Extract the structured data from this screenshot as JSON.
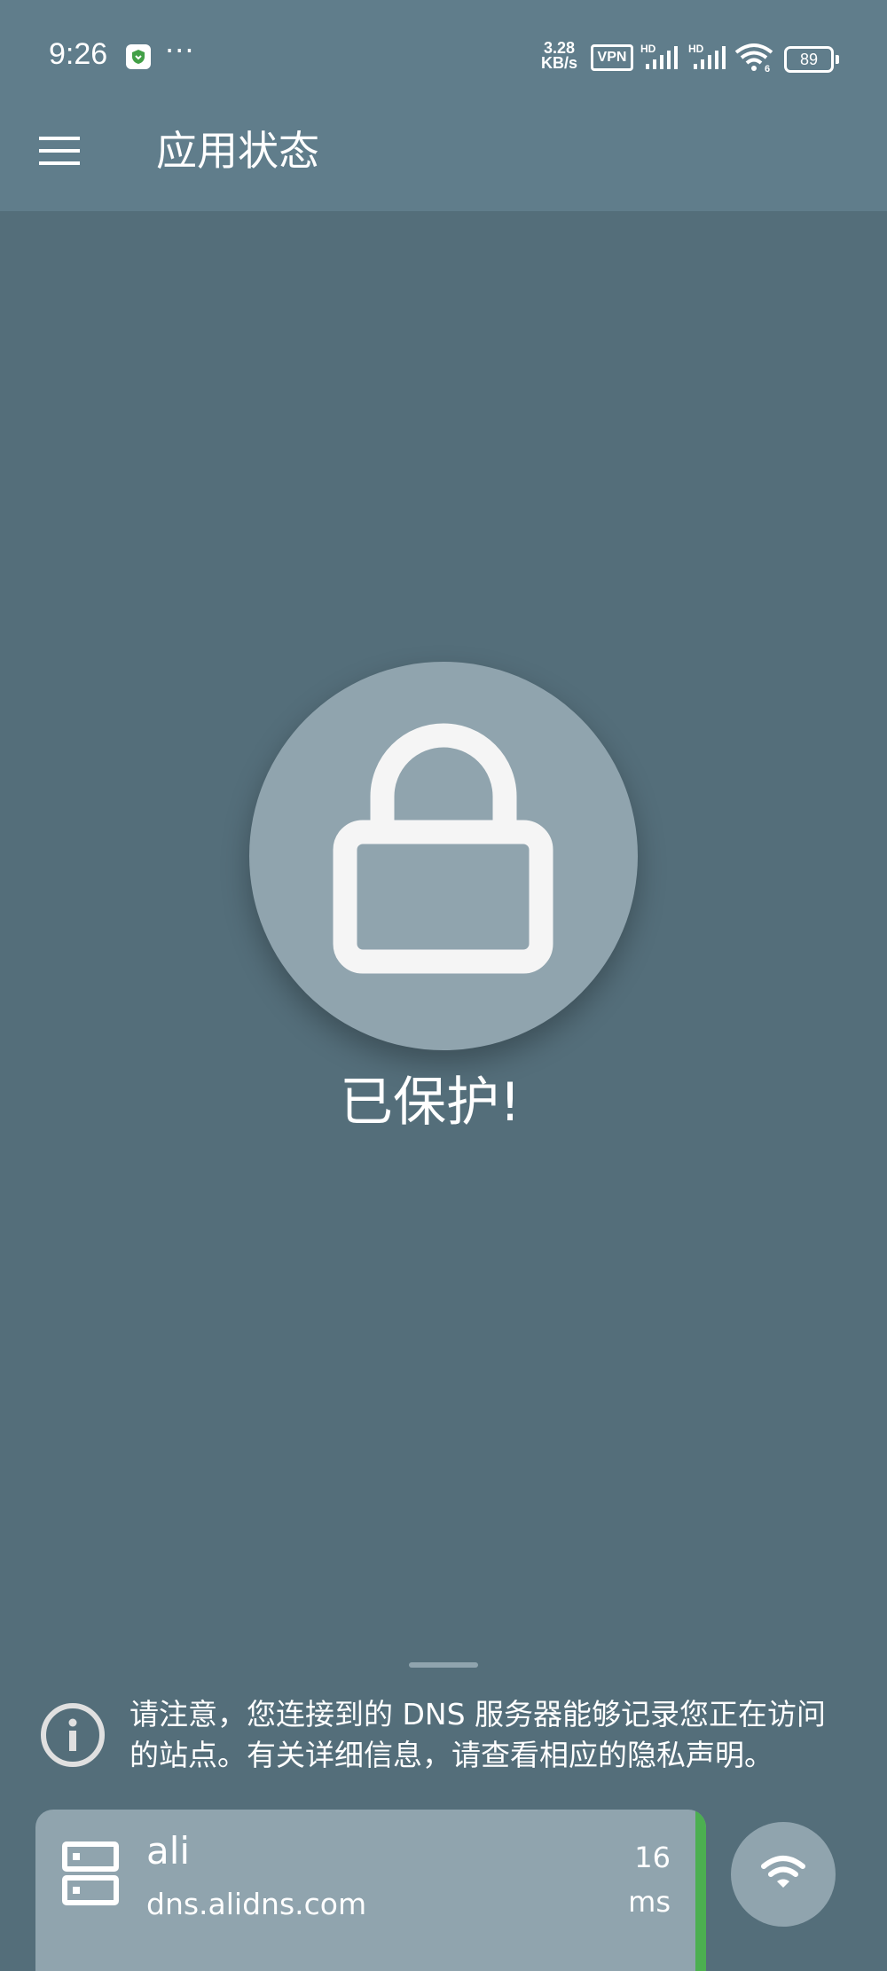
{
  "status_bar": {
    "time": "9:26",
    "net_speed_value": "3.28",
    "net_speed_unit": "KB/s",
    "vpn_label": "VPN",
    "signal_label": "HD",
    "wifi_label": "6",
    "battery_level": "89"
  },
  "header": {
    "title": "应用状态"
  },
  "main": {
    "status_text": "已保护!"
  },
  "notice": {
    "text": "请注意，您连接到的 DNS 服务器能够记录您正在访问的站点。有关详细信息，请查看相应的隐私声明。"
  },
  "server": {
    "name": "ali",
    "host": "dns.alidns.com",
    "latency_value": "16",
    "latency_unit": "ms"
  },
  "colors": {
    "header_bg": "#607d8b",
    "page_bg": "#546e7a",
    "accent": "#90a4ae",
    "latency_good": "#4caf50"
  }
}
